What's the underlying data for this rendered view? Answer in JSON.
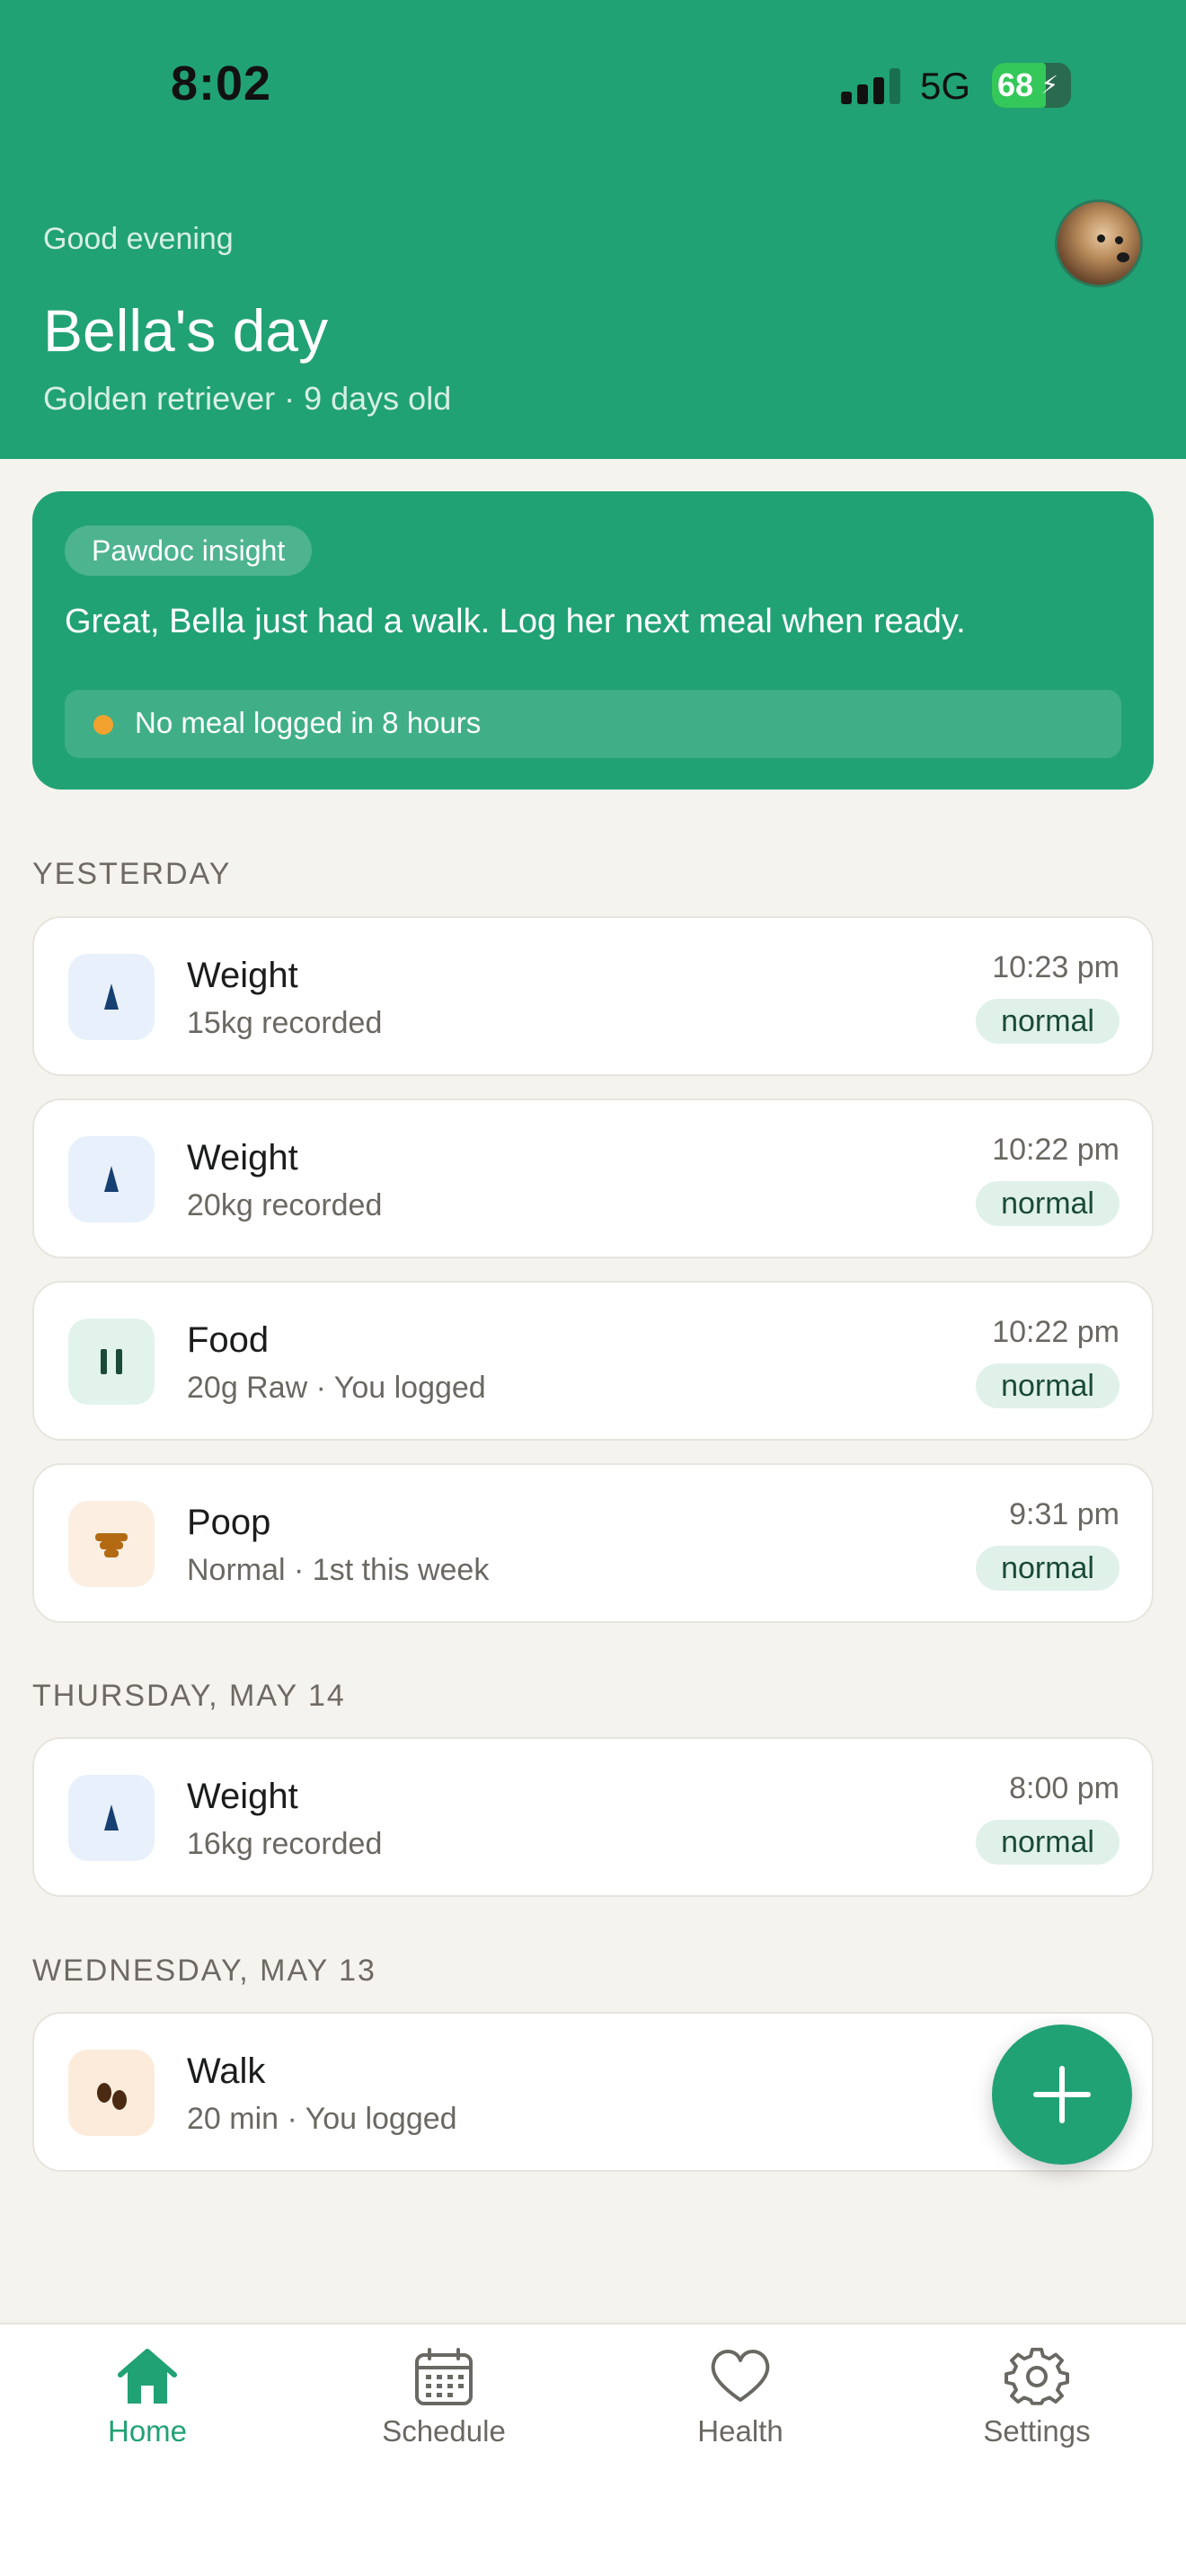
{
  "status": {
    "time": "8:02",
    "network": "5G",
    "battery": "68",
    "battery_level": 0.68
  },
  "header": {
    "greeting": "Good evening",
    "title": "Bella's day",
    "subtitle": "Golden retriever · 9 days old"
  },
  "insight": {
    "badge": "Pawdoc insight",
    "message": "Great, Bella just had a walk. Log her next meal when ready.",
    "alert": "No meal logged in 8 hours",
    "alert_color": "#f2a22e"
  },
  "sections": [
    {
      "label": "YESTERDAY",
      "entries": [
        {
          "icon": "weight-icon",
          "title": "Weight",
          "subtitle": "15kg recorded",
          "time": "10:23 pm",
          "status": "normal"
        },
        {
          "icon": "weight-icon",
          "title": "Weight",
          "subtitle": "20kg recorded",
          "time": "10:22 pm",
          "status": "normal"
        },
        {
          "icon": "food-icon",
          "title": "Food",
          "subtitle": "20g Raw · You logged",
          "time": "10:22 pm",
          "status": "normal"
        },
        {
          "icon": "poop-icon",
          "title": "Poop",
          "subtitle": "Normal · 1st this week",
          "time": "9:31 pm",
          "status": "normal"
        }
      ]
    },
    {
      "label": "THURSDAY, MAY 14",
      "entries": [
        {
          "icon": "weight-icon",
          "title": "Weight",
          "subtitle": "16kg recorded",
          "time": "8:00 pm",
          "status": "normal"
        }
      ]
    },
    {
      "label": "WEDNESDAY, MAY 13",
      "entries": [
        {
          "icon": "walk-icon",
          "title": "Walk",
          "subtitle": "20 min · You logged"
        }
      ]
    }
  ],
  "tabs": [
    {
      "label": "Home",
      "icon": "home-icon",
      "active": true
    },
    {
      "label": "Schedule",
      "icon": "calendar-icon",
      "active": false
    },
    {
      "label": "Health",
      "icon": "heart-icon",
      "active": false
    },
    {
      "label": "Settings",
      "icon": "gear-icon",
      "active": false
    }
  ],
  "colors": {
    "brand": "#21a274",
    "background": "#f5f3ee",
    "badge_bg": "#e0f1ea"
  }
}
